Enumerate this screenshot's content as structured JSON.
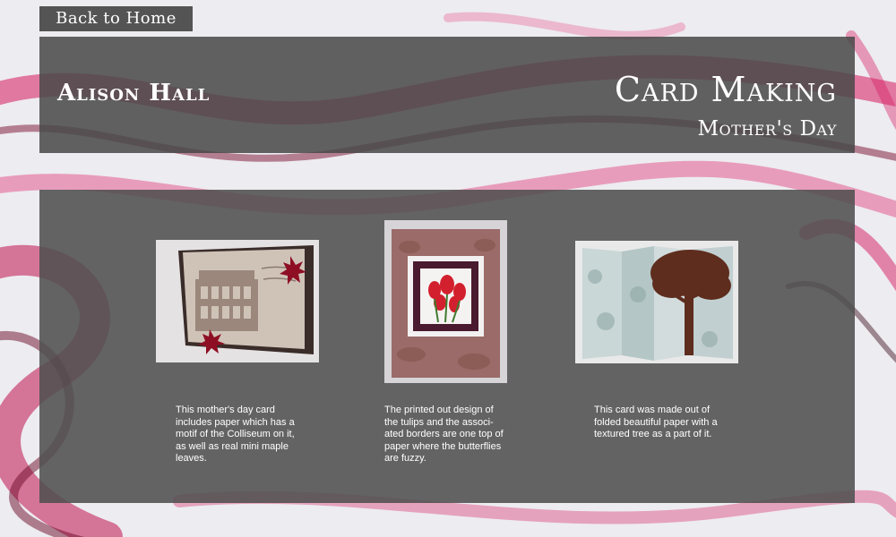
{
  "nav": {
    "back_label": "Back to Home"
  },
  "header": {
    "author": "Alison Hall",
    "section_title": "Card Making",
    "section_subtitle": "Mother's Day"
  },
  "cards": [
    {
      "icon": "colosseum-card-photo",
      "caption": "This mother's day card includes paper which has a motif of the Colliseum on it, as well as real mini maple leaves."
    },
    {
      "icon": "tulip-card-photo",
      "caption": "The printed out design of the tulips and the associ-ated borders are one top of paper where the butterflies are fuzzy."
    },
    {
      "icon": "tree-card-photo",
      "caption": "This card was made out of folded beautiful paper with a textured tree as a part of it."
    }
  ],
  "colors": {
    "panel": "#484848",
    "accent": "#d6195f",
    "text": "#ffffff"
  }
}
